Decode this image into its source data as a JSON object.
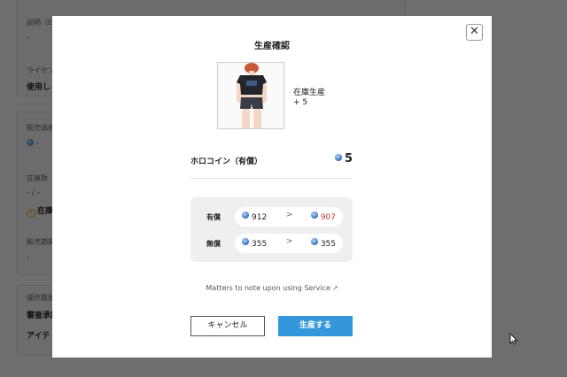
{
  "background": {
    "card1": {
      "desc_label": "説明（E",
      "desc_value": "-",
      "license_label": "ライセン",
      "license_value": "使用し"
    },
    "card2": {
      "price_label": "販売価格",
      "price_value": "-",
      "stock_label": "在庫数（",
      "stock_value": "- / -",
      "stock_warning": "在庫",
      "period_label": "販売期間",
      "period_value": "-"
    },
    "card3": {
      "history_label": "操作履歴",
      "history_line1": "審査承認",
      "history_line2": "アイテ"
    }
  },
  "modal": {
    "close_label": "✕",
    "title": "生産確認",
    "product": {
      "name": "在庫生産",
      "quantity": "+ 5"
    },
    "currency": {
      "label": "ホロコイン（有償）",
      "cost": "5"
    },
    "balances": [
      {
        "label": "有償",
        "from": "912",
        "arrow": ">",
        "to": "907",
        "to_highlight": true
      },
      {
        "label": "無償",
        "from": "355",
        "arrow": ">",
        "to": "355",
        "to_highlight": false
      }
    ],
    "notice_link": "Matters to note upon using Service",
    "notice_icon": "↗",
    "buttons": {
      "cancel": "キャンセル",
      "produce": "生産する"
    }
  },
  "colors": {
    "accent": "#3597db",
    "decrease": "#c0392b",
    "coin": "#2f6ec2"
  }
}
